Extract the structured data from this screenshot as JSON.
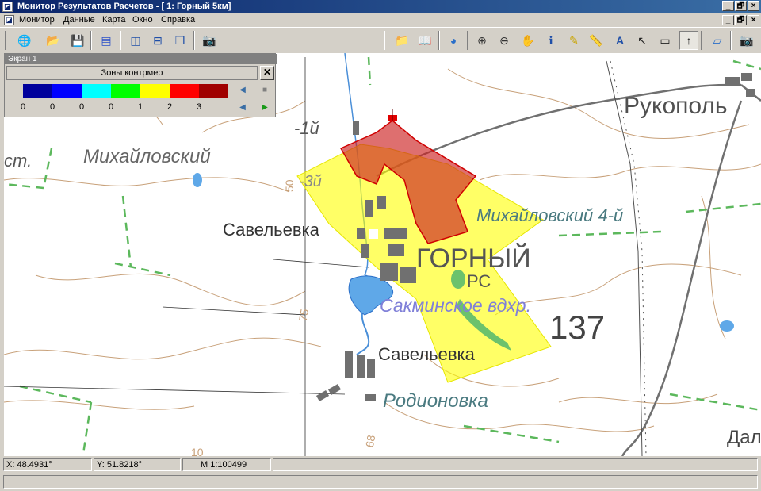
{
  "window": {
    "title": "Монитор Результатов Расчетов - [ 1: Горный 5км]",
    "min": "_",
    "max": "🗗",
    "close": "×"
  },
  "menu": {
    "items": [
      "Монитор",
      "Данные",
      "Карта",
      "Окно",
      "Справка"
    ]
  },
  "toolbar": {
    "left_icons": [
      "globe-icon",
      "open-folder-icon",
      "save-icon",
      "layers-icon",
      "split-vertical-icon",
      "split-horizontal-icon",
      "cascade-windows-icon",
      "camera-icon"
    ],
    "right_icons": [
      "open-map-icon",
      "book-icon",
      "globe-small-icon",
      "zoom-in-icon",
      "zoom-out-icon",
      "pan-hand-icon",
      "info-icon",
      "measure-pencil-icon",
      "ruler-icon",
      "text-label-icon",
      "pointer-icon",
      "select-rect-icon",
      "north-arrow-icon",
      "eraser-icon",
      "camera-right-icon"
    ],
    "glyphs": {
      "globe": "🌐",
      "open": "📂",
      "save": "💾",
      "layers": "▤",
      "splitv": "◫",
      "splith": "⊟",
      "cascade": "❐",
      "camera": "📷",
      "openmap": "📁",
      "book": "📖",
      "globe2": "◕",
      "zoomin": "⊕",
      "zoomout": "⊖",
      "hand": "✋",
      "info": "ℹ",
      "pencil": "✎",
      "ruler": "📏",
      "text": "A",
      "pointer": "↖",
      "selrect": "▭",
      "north": "↑",
      "eraser": "▱",
      "camera2": "📷"
    }
  },
  "panel": {
    "header": "Экран 1",
    "legend_title": "Зоны контрмер",
    "close": "✕",
    "swatch_colors": [
      "#00009c",
      "#0000ff",
      "#00ffff",
      "#00ff00",
      "#ffff00",
      "#ff0000",
      "#a00000"
    ],
    "numbers": [
      "0",
      "0",
      "0",
      "0",
      "1",
      "2",
      "3"
    ],
    "controls": {
      "prev_top": "◀",
      "stop": "■",
      "prev_bottom": "◀",
      "play": "▶"
    }
  },
  "map": {
    "labels": {
      "rukopol": "Рукополь",
      "mikh_st": "ст.",
      "mikhailovsky": "Михайловский",
      "savelievka1": "Савельевка",
      "mikhailovsky4": "Михайловский 4-й",
      "gorny": "ГОРНЫЙ",
      "rs": "РС",
      "reservoir": "Сакминское вдхр.",
      "height137": "137",
      "savelievka2": "Савельевка",
      "rodionovka": "Родионовка",
      "dal": "Дал",
      "one_y": "-1й",
      "three_y": "-3й",
      "num50": "50",
      "num75": "75",
      "num68": "68",
      "num10": "10"
    },
    "zone_colors": {
      "yellow": "#ffff00",
      "red": "#cc3333"
    }
  },
  "status": {
    "x": "X: 48.4931°",
    "y": "Y: 51.8218°",
    "scale": "М 1:100499"
  }
}
